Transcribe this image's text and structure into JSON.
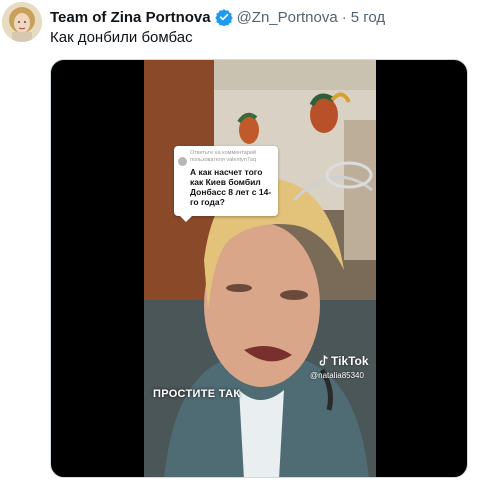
{
  "tweet": {
    "author_name": "Team of Zina Portnova",
    "handle": "@Zn_Portnova",
    "separator": "·",
    "time": "5 год",
    "text": "Как донбили бомбас",
    "verified_icon": "verified-badge-icon",
    "verified_color": "#1d9bf0"
  },
  "video": {
    "reply_meta": "Ответьте на комментарий пользователя valentyn7aq",
    "reply_question": "А как насчет того как Киев бомбил Донбасс 8 лет с 14-го года?",
    "watermark_brand": "TikTok",
    "watermark_handle": "@natalia85340",
    "caption": "ПРОСТИТЕ ТАК"
  }
}
